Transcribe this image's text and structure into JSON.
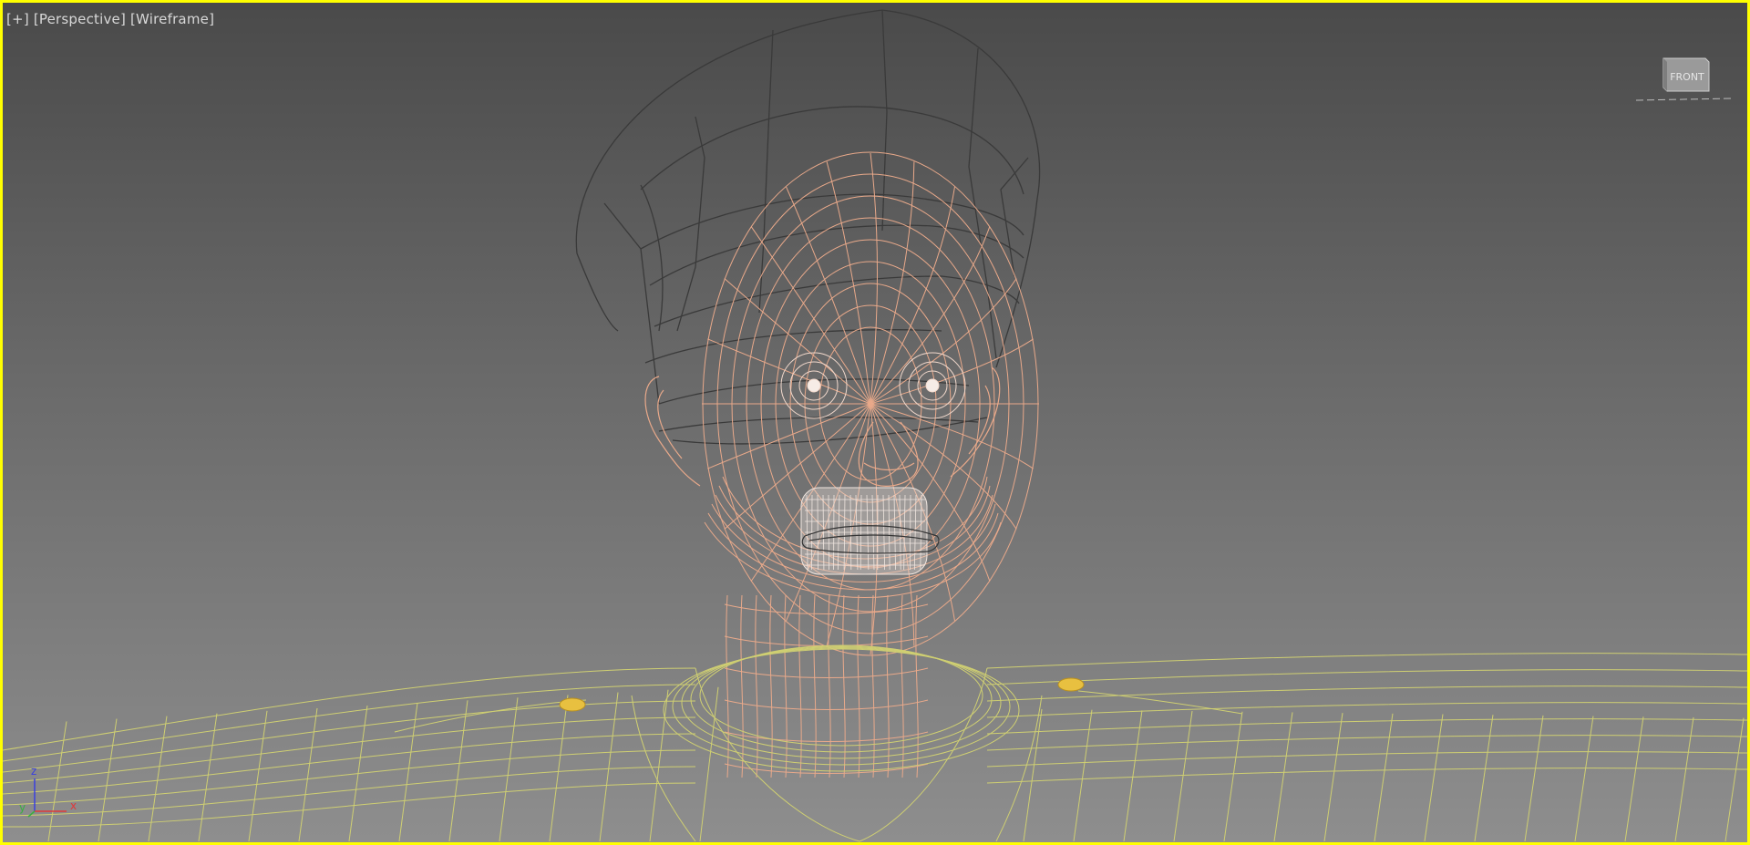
{
  "viewport": {
    "label": {
      "plus": "[+]",
      "view": "[Perspective]",
      "shading": "[Wireframe]"
    },
    "active_border_color": "#ffff00",
    "background_top": "#4a4a4a",
    "background_bottom": "#8e8e8e"
  },
  "viewcube": {
    "face_label": "FRONT",
    "icon": "viewcube-icon"
  },
  "axis_tripod": {
    "z_label": "z",
    "y_label": "y",
    "x_label": "x"
  },
  "scene": {
    "object": "character-head-wireframe",
    "colors": {
      "skin": "#e9a98a",
      "hat": "#3a3a3a",
      "body": "#cfcf72",
      "teeth": "#f0e6e0",
      "gold_badge": "#e8c040"
    }
  }
}
